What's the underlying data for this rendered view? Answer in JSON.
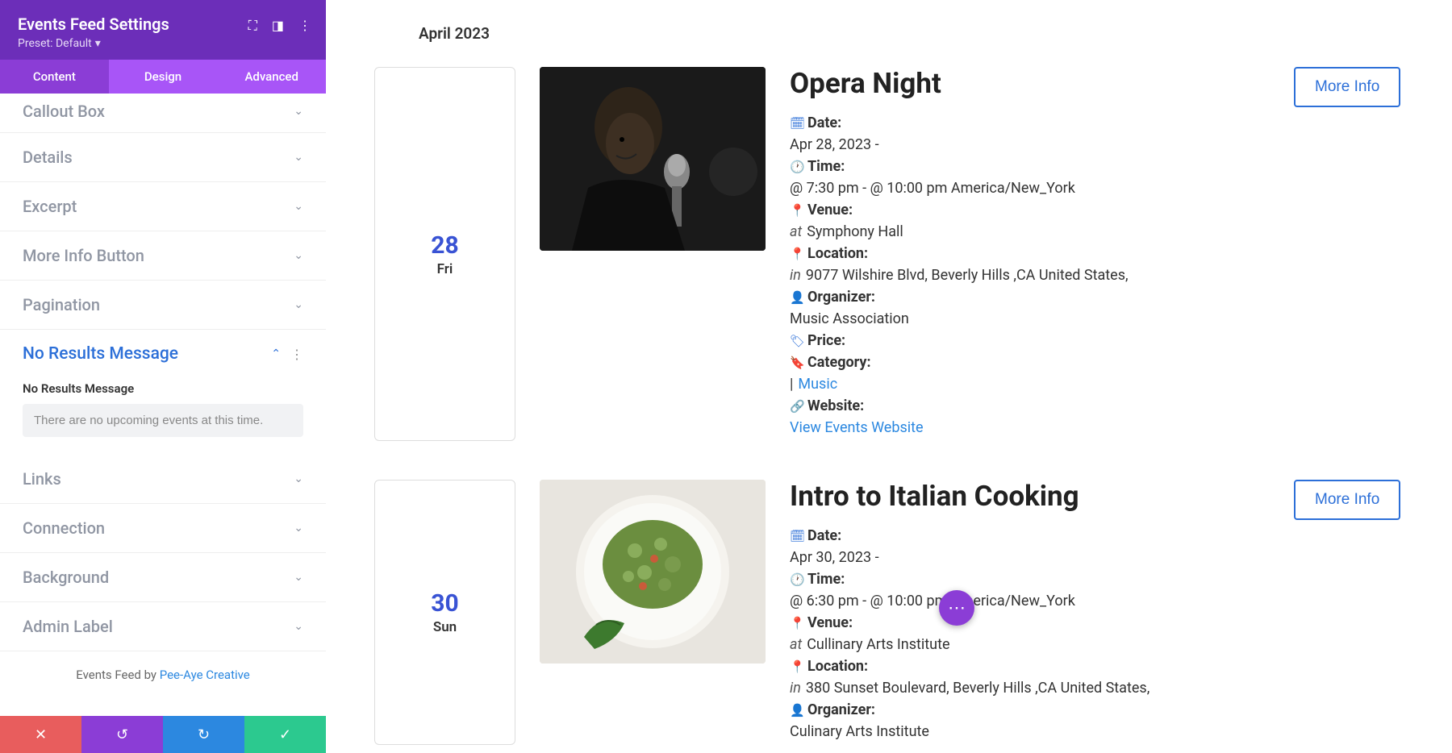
{
  "sidebar": {
    "title": "Events Feed Settings",
    "preset": "Preset: Default",
    "tabs": {
      "content": "Content",
      "design": "Design",
      "advanced": "Advanced"
    },
    "sections": {
      "callout": "Callout Box",
      "details": "Details",
      "excerpt": "Excerpt",
      "moreinfo": "More Info Button",
      "pagination": "Pagination",
      "noresults": "No Results Message",
      "links": "Links",
      "connection": "Connection",
      "background": "Background",
      "adminlabel": "Admin Label"
    },
    "noresults_field_label": "No Results Message",
    "noresults_value": "There are no upcoming events at this time.",
    "footer_text": "Events Feed by ",
    "footer_link": "Pee-Aye Creative"
  },
  "preview": {
    "month": "April 2023",
    "events": [
      {
        "day_num": "28",
        "day_name": "Fri",
        "title": "Opera Night",
        "date_label": "Date:",
        "date_value": "Apr 28, 2023 -",
        "time_label": "Time:",
        "time_value": "@ 7:30 pm - @ 10:00 pm America/New_York",
        "venue_label": "Venue:",
        "venue_value": "Symphony Hall",
        "location_label": "Location:",
        "location_value": "9077 Wilshire Blvd, Beverly Hills ,CA United States,",
        "organizer_label": "Organizer:",
        "organizer_value": "Music Association",
        "price_label": "Price:",
        "category_label": "Category:",
        "category_value": "Music",
        "website_label": "Website:",
        "website_link": "View Events Website",
        "more_info": "More Info"
      },
      {
        "day_num": "30",
        "day_name": "Sun",
        "title": "Intro to Italian Cooking",
        "date_label": "Date:",
        "date_value": "Apr 30, 2023 -",
        "time_label": "Time:",
        "time_value": "@ 6:30 pm - @ 10:00 pm America/New_York",
        "venue_label": "Venue:",
        "venue_value": "Cullinary Arts Institute",
        "location_label": "Location:",
        "location_value": "380 Sunset Boulevard, Beverly Hills ,CA United States,",
        "organizer_label": "Organizer:",
        "organizer_value": "Culinary Arts Institute",
        "more_info": "More Info"
      }
    ],
    "at_prefix": "at ",
    "in_prefix": "in ",
    "pipe": "| "
  }
}
